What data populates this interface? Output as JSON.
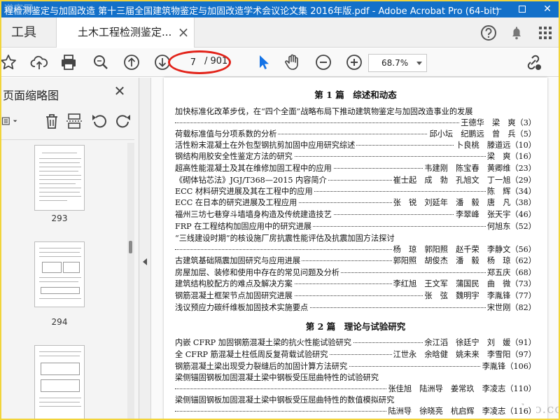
{
  "window": {
    "title": "程检测鉴定与加固改造 第十三届全国建筑物鉴定与加固改造学术会议论文集 2016年版.pdf - Adobe Acrobat Pro (64-bit)",
    "watermark": "道客网",
    "minimize_label": "—",
    "close_label": "✕"
  },
  "tabs": {
    "tools_label": "工具",
    "doc_label": "土木工程检测鉴定...",
    "doc_close": "×"
  },
  "toolbar": {
    "page_current": "7",
    "page_total": "/ 901",
    "zoom": "68.7%"
  },
  "sidebar": {
    "title": "页面缩略图",
    "close_label": "✕",
    "thumbnails": [
      {
        "label": "293"
      },
      {
        "label": "294"
      }
    ]
  },
  "toc": {
    "sections": [
      {
        "title": "第 1 篇　综述和动态"
      },
      {
        "title": "第 2 篇　理论与试验研究"
      }
    ],
    "entries": [
      {
        "title": "加快标准化改革步伐，在“四个全面”战略布局下推动建筑物鉴定与加固改造事业的发展",
        "authors": ""
      },
      {
        "title": "",
        "authors": "王德华　梁　爽（3）"
      },
      {
        "title": "荷载标准值与分项系数的分析",
        "authors": "邱小坛　纪鹏远　曾　兵（5）"
      },
      {
        "title": "活性粉末混凝土在外包型钢抗剪加固中应用研究综述",
        "authors": "卜良桃　滕道远（10）"
      },
      {
        "title": "钢结构用胶安全性鉴定方法的研究",
        "authors": "梁　爽（16）"
      },
      {
        "title": "超高性能混凝土及其在维修加固工程中的应用",
        "authors": "韦建刚　陈宝春　黄卿维（23）"
      },
      {
        "title": "《砌体钻芯法》JGJ/T368—2015 内容简介",
        "authors": "崔士起　成　勃　孔旭文　丁一旭（29）"
      },
      {
        "title": "ECC 材料研究进展及其在工程中的应用",
        "authors": "陈　辉（34）"
      },
      {
        "title": "ECC 在日本的研究进展及工程应用",
        "authors": "张　锐　刘延年　潘　毅　唐　凡（38）"
      },
      {
        "title": "福州三坊七巷穿斗墙墙身构造及传统建造技艺",
        "authors": "李翠峰　张天宇（46）"
      },
      {
        "title": "FRP 在工程结构加固应用中的研究进展",
        "authors": "何旭东（52）"
      },
      {
        "title": "“三线建设时期”的核设施厂房抗震性能评估及抗震加固方法探讨",
        "authors": ""
      },
      {
        "title": "",
        "authors": "杨　琼　郭阳照　赵千荣　李静文（56）"
      },
      {
        "title": "古建筑基础隔震加固研究与应用进展",
        "authors": "郭阳照　胡俊杰　潘　毅　杨　琼（62）"
      },
      {
        "title": "房屋加层、装修和使用中存在的常见问题及分析",
        "authors": "郑五庆（68）"
      },
      {
        "title": "建筑结构胶配方的难点及解决方案",
        "authors": "李红旭　王文军　蒲国民　曲　微（73）"
      },
      {
        "title": "钢筋混凝土框架节点加固研究进展",
        "authors": "张　弦　魏明宇　李胤锋（77）"
      },
      {
        "title": "浅议预应力碳纤维板加固技术实施要点",
        "authors": "宋世刚（82）"
      },
      {
        "title": "内嵌 CFRP 加固钢筋混凝土梁的抗火性能试验研究",
        "authors": "余江滔　徐廷宁　刘　媛（91）"
      },
      {
        "title": "全 CFRP 筋混凝土柱低周反复荷载试验研究",
        "authors": "江世永　余晗健　姚未来　李雪阳（97）"
      },
      {
        "title": "钢筋混凝土梁出现受力裂缝后的加固计算方法研究",
        "authors": "李胤锋（106）"
      },
      {
        "title": "梁侧锚固钢板加固混凝土梁中钢板受压屈曲特性的试验研究",
        "authors": ""
      },
      {
        "title": "",
        "authors": "张佳旭　陆洲导　姜常玖　李凌志（110）"
      },
      {
        "title": "梁侧锚固钢板加固混凝土梁中钢板受压屈曲特性的数值模拟研究",
        "authors": ""
      },
      {
        "title": "",
        "authors": "陆洲导　徐晓亮　杭启辉　李凌志（116）"
      }
    ]
  },
  "watermark_bottom": "www.codao.com",
  "colors": {
    "titlebar": "#1370c9",
    "accent_ellipse": "#e2231a",
    "frame": "#f1d43a",
    "select_tool": "#1473e6"
  }
}
